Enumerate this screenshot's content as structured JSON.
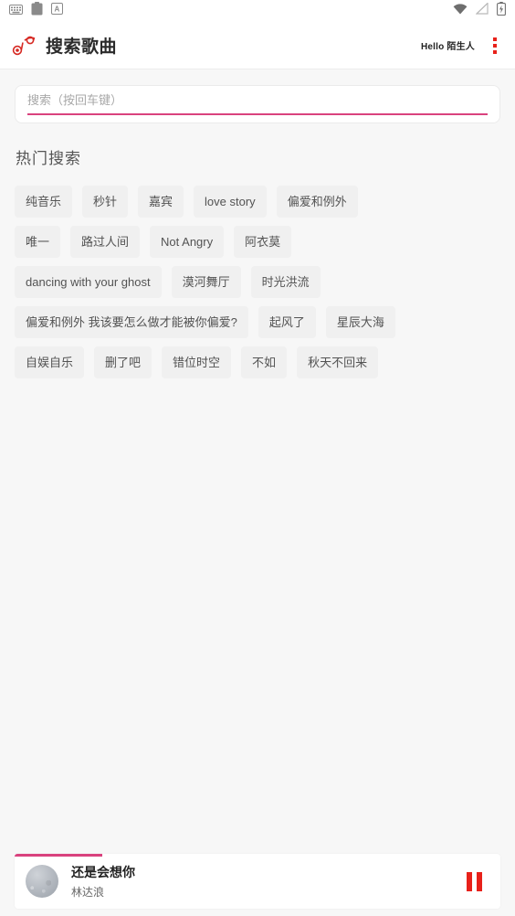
{
  "statusbar": {
    "left_icons": [
      {
        "name": "keyboard-icon",
        "label": "keyboard"
      },
      {
        "name": "clipboard-icon",
        "label": "clipboard"
      },
      {
        "name": "input-method-a-icon",
        "label": "A"
      }
    ],
    "right_icons": [
      {
        "name": "wifi-icon",
        "label": "wifi"
      },
      {
        "name": "no-sim-icon",
        "label": "no-signal"
      },
      {
        "name": "battery-charging-icon",
        "label": "battery-charging"
      }
    ]
  },
  "header": {
    "logo_icon": "music-note-logo-icon",
    "title": "搜索歌曲",
    "greeting": "Hello 陌生人",
    "menu_icon": "more-vertical-icon"
  },
  "search": {
    "placeholder": "搜索（按回车键）",
    "value": "",
    "underline_color": "#d9427e"
  },
  "hot": {
    "section_title": "热门搜索",
    "tags": [
      "纯音乐",
      "秒针",
      "嘉宾",
      "love story",
      "偏爱和例外",
      "唯一",
      "路过人间",
      "Not Angry",
      "阿衣莫",
      "dancing with your ghost",
      "漠河舞厅",
      "时光洪流",
      "偏爱和例外 我该要怎么做才能被你偏爱?",
      "起风了",
      "星辰大海",
      "自娱自乐",
      "删了吧",
      "错位时空",
      "不如",
      "秋天不回来"
    ]
  },
  "player": {
    "title": "还是会想你",
    "artist": "林达浪",
    "progress_percent": 18,
    "progress_color": "#d9427e",
    "control_icon": "pause-icon",
    "control_color": "#e8211a",
    "cover_icon": "album-cover"
  }
}
